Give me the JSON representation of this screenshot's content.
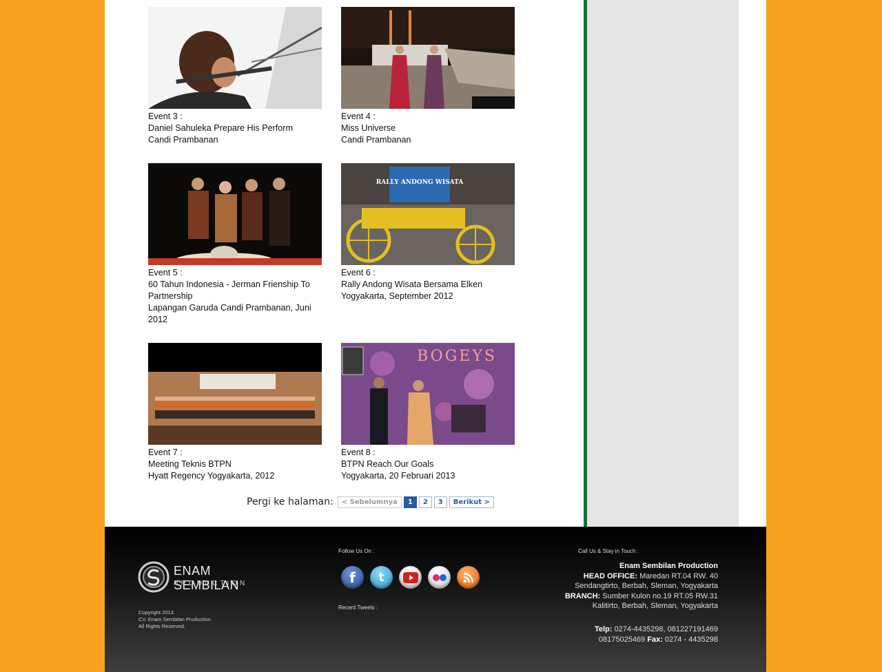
{
  "events": [
    {
      "label": "Event 3 :",
      "title": "Daniel Sahuleka Prepare His Perform",
      "place": "Candi Prambanan"
    },
    {
      "label": "Event 4 :",
      "title": "Miss Universe",
      "place": "Candi Prambanan"
    },
    {
      "label": "Event 5 :",
      "title": "60 Tahun Indonesia - Jerman Frienship To Partnership",
      "place": "Lapangan Garuda Candi Prambanan, Juni 2012"
    },
    {
      "label": "Event 6 :",
      "title": "Rally Andong Wisata Bersama Elken",
      "place": "Yogyakarta, September 2012"
    },
    {
      "label": "Event 7 :",
      "title": "Meeting Teknis BTPN",
      "place": "Hyatt Regency Yogyakarta, 2012"
    },
    {
      "label": "Event 8 :",
      "title": "BTPN Reach Our Goals",
      "place": "Yogyakarta, 20 Februari 2013"
    }
  ],
  "photo_text": {
    "rally_banner": "RALLY ANDONG WISATA",
    "bogeys": "BOGEYS"
  },
  "pager": {
    "label": "Pergi ke halaman:",
    "prev": "< Sebelumnya",
    "pages": [
      "1",
      "2",
      "3"
    ],
    "next": "Berikut >"
  },
  "footer": {
    "logo_main": "ENAM SEMBILAN",
    "logo_sub": "PRODUCTION",
    "copyright": [
      "Copyright 2013.",
      "CV. Enam Sembilan Production.",
      "All Rights Reserved."
    ],
    "follow_title": "Follow Us On :",
    "recent_tweets": "Recent Tweets :",
    "contact_title": "Call Us & Stay in Touch :",
    "company": "Enam Sembilan Production",
    "head_office_label": "HEAD OFFICE:",
    "head_office_1": "Maredan RT.04 RW. 40",
    "head_office_2": "Sendangtirto, Berbah, Sleman, Yogyakarta",
    "branch_label": "BRANCH:",
    "branch_1": "Sumber Kulon no.19 RT.05 RW.31",
    "branch_2": "Kalitirto, Berbah, Sleman, Yogyakarta",
    "telp_label": "Telp:",
    "telp": "0274-4435298, 081227191469",
    "telp2": "08175025469",
    "fax_label": "Fax:",
    "fax": "0274 - 4435298"
  },
  "social_icons": [
    "facebook-icon",
    "twitter-icon",
    "youtube-icon",
    "flickr-icon",
    "rss-icon"
  ],
  "colors": {
    "background": "#f7a11f",
    "divider": "#1d6b3a",
    "sidebar": "#e5e5e5",
    "link": "#2a5aa0"
  }
}
